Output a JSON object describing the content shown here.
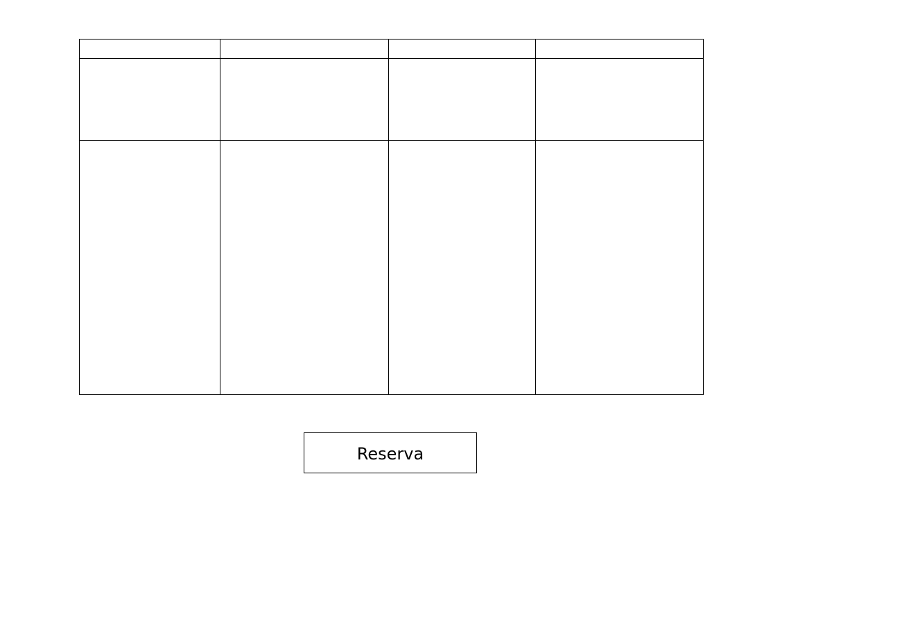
{
  "table": {
    "rows": [
      [
        "",
        "",
        "",
        ""
      ],
      [
        "",
        "",
        "",
        ""
      ],
      [
        "",
        "",
        "",
        ""
      ]
    ]
  },
  "actions": {
    "reserve_label": "Reserva"
  }
}
